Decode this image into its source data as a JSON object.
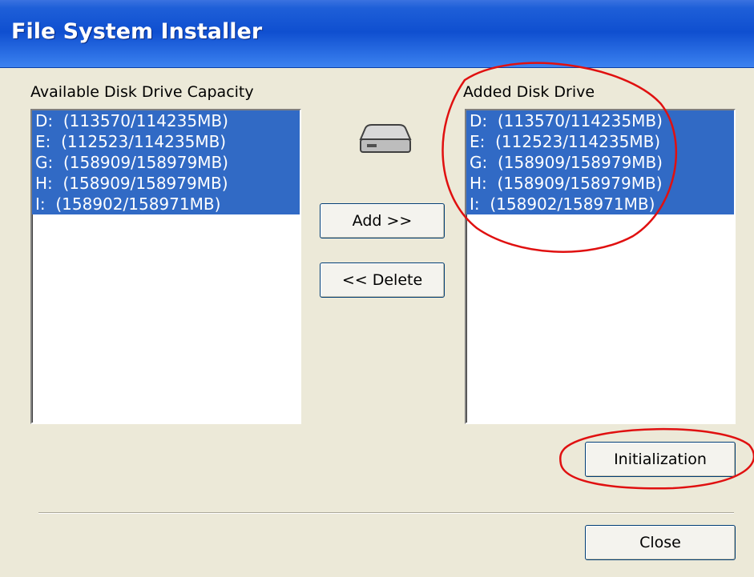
{
  "window": {
    "title": "File System Installer"
  },
  "available": {
    "label": "Available Disk Drive Capacity",
    "items": [
      "D:  (113570/114235MB)",
      "E:  (112523/114235MB)",
      "G:  (158909/158979MB)",
      "H:  (158909/158979MB)",
      "I:  (158902/158971MB)"
    ]
  },
  "added": {
    "label": "Added Disk Drive",
    "items": [
      "D:  (113570/114235MB)",
      "E:  (112523/114235MB)",
      "G:  (158909/158979MB)",
      "H:  (158909/158979MB)",
      "I:  (158902/158971MB)"
    ]
  },
  "buttons": {
    "add": "Add >>",
    "delete": "<< Delete",
    "initialization": "Initialization",
    "close": "Close"
  },
  "icons": {
    "drive": "hard-drive-icon"
  },
  "colors": {
    "selection": "#316ac5",
    "titlebar": "#0f4fd0",
    "annotation": "#e01010"
  }
}
